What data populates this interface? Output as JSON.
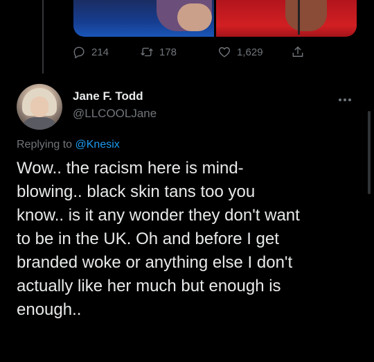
{
  "media": {
    "colors": {
      "left_bg": "#163d8f",
      "right_bg": "#d11f23"
    }
  },
  "actions": {
    "reply_count": "214",
    "retweet_count": "178",
    "like_count": "1,629"
  },
  "tweet": {
    "author_name": "Jane F. Todd",
    "author_handle": "@LLCOOLJane",
    "replying_prefix": "Replying to",
    "replying_to": "@Knesix",
    "lines": [
      "Wow.. the racism here is mind-",
      "blowing.. black skin tans too you",
      "know.. is it any wonder they don't want",
      "to be in the UK. Oh and before I get",
      "branded woke or anything else I don't",
      "actually like her much but enough is",
      "enough.."
    ]
  },
  "theme": {
    "background": "#000000",
    "text": "#e7e9ea",
    "muted": "#71767b",
    "accent": "#1d9bf0"
  },
  "icons": [
    "reply-icon",
    "retweet-icon",
    "like-icon",
    "share-icon",
    "more-icon"
  ]
}
